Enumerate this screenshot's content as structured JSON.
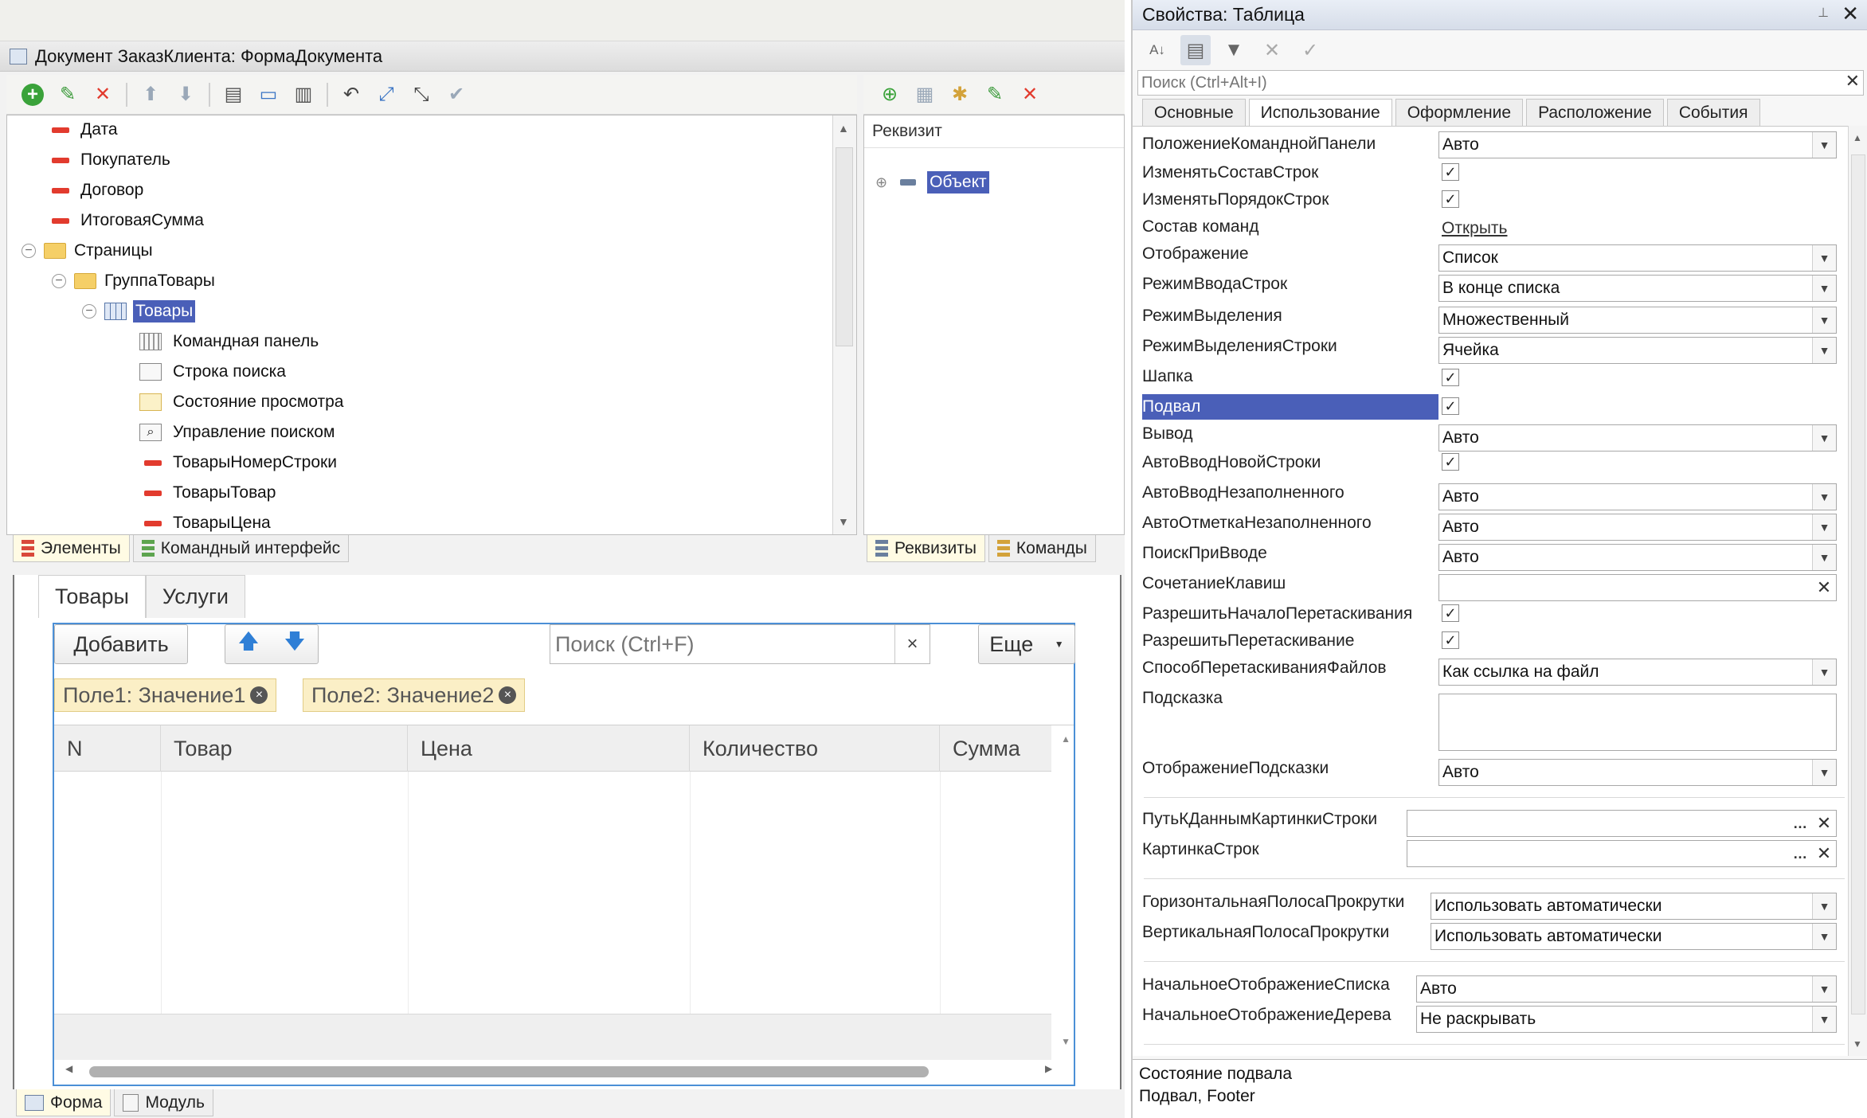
{
  "left_window": {
    "title": "Документ ЗаказКлиента: ФормаДокумента",
    "elements_tree": [
      {
        "label": "Дата",
        "icon": "attribute-icon"
      },
      {
        "label": "Покупатель",
        "icon": "attribute-icon"
      },
      {
        "label": "Договор",
        "icon": "attribute-icon"
      },
      {
        "label": "ИтоговаяСумма",
        "icon": "attribute-icon"
      },
      {
        "label": "Страницы",
        "icon": "folder-icon"
      },
      {
        "label": "ГруппаТовары",
        "icon": "folder-icon"
      },
      {
        "label": "Товары",
        "icon": "table-icon"
      },
      {
        "label": "Командная панель",
        "icon": "command-bar-icon"
      },
      {
        "label": "Строка поиска",
        "icon": "search-string-icon"
      },
      {
        "label": "Состояние просмотра",
        "icon": "view-status-icon"
      },
      {
        "label": "Управление поиском",
        "icon": "search-control-icon"
      },
      {
        "label": "ТоварыНомерСтроки",
        "icon": "attribute-icon"
      },
      {
        "label": "ТоварыТовар",
        "icon": "attribute-icon"
      },
      {
        "label": "ТоварыЦена",
        "icon": "attribute-icon"
      }
    ],
    "elements_tabs": [
      "Элементы",
      "Командный интерфейс"
    ],
    "requisites_header": "Реквизит",
    "requisite_object": "Объект",
    "requisites_tabs": [
      "Реквизиты",
      "Команды"
    ],
    "preview": {
      "tabs": [
        "Товары",
        "Услуги"
      ],
      "add_button": "Добавить",
      "search_placeholder": "Поиск (Ctrl+F)",
      "more_button": "Еще",
      "filters": [
        "Поле1: Значение1",
        "Поле2: Значение2"
      ],
      "columns": [
        "N",
        "Товар",
        "Цена",
        "Количество",
        "Сумма"
      ]
    },
    "bottom_tabs": [
      "Форма",
      "Модуль"
    ]
  },
  "properties": {
    "title": "Свойства: Таблица",
    "search_placeholder": "Поиск (Ctrl+Alt+I)",
    "tabs": [
      "Основные",
      "Использование",
      "Оформление",
      "Расположение",
      "События"
    ],
    "rows": {
      "r1": {
        "label": "ПоложениеКоманднойПанели",
        "value": "Авто"
      },
      "r2": {
        "label": "ИзменятьСоставСтрок"
      },
      "r3": {
        "label": "ИзменятьПорядокСтрок"
      },
      "r4": {
        "label": "Состав команд",
        "value": "Открыть"
      },
      "r5": {
        "label": "Отображение",
        "value": "Список"
      },
      "r6": {
        "label": "РежимВводаСтрок",
        "value": "В конце списка"
      },
      "r7": {
        "label": "РежимВыделения",
        "value": "Множественный"
      },
      "r8": {
        "label": "РежимВыделенияСтроки",
        "value": "Ячейка"
      },
      "r9": {
        "label": "Шапка"
      },
      "r10": {
        "label": "Подвал"
      },
      "r11": {
        "label": "Вывод",
        "value": "Авто"
      },
      "r12": {
        "label": "АвтоВводНовойСтроки"
      },
      "r13": {
        "label": "АвтоВводНезаполненного",
        "value": "Авто"
      },
      "r14": {
        "label": "АвтоОтметкаНезаполненного",
        "value": "Авто"
      },
      "r15": {
        "label": "ПоискПриВводе",
        "value": "Авто"
      },
      "r16": {
        "label": "СочетаниеКлавиш",
        "value": ""
      },
      "r17": {
        "label": "РазрешитьНачалоПеретаскивания"
      },
      "r18": {
        "label": "РазрешитьПеретаскивание"
      },
      "r19": {
        "label": "СпособПеретаскиванияФайлов",
        "value": "Как ссылка на файл"
      },
      "r20": {
        "label": "Подсказка",
        "value": ""
      },
      "r21": {
        "label": "ОтображениеПодсказки",
        "value": "Авто"
      },
      "r22": {
        "label": "ПутьКДаннымКартинкиСтроки",
        "value": ""
      },
      "r23": {
        "label": "КартинкаСтрок",
        "value": ""
      },
      "r24": {
        "label": "ГоризонтальнаяПолосаПрокрутки",
        "value": "Использовать автоматически"
      },
      "r25": {
        "label": "ВертикальнаяПолосаПрокрутки",
        "value": "Использовать автоматически"
      },
      "r26": {
        "label": "НачальноеОтображениеСписка",
        "value": "Авто"
      },
      "r27": {
        "label": "НачальноеОтображениеДерева",
        "value": "Не раскрывать"
      }
    },
    "status_title": "Состояние подвала",
    "status_text": "Подвал, Footer"
  },
  "colors": {
    "selection": "#4a5fb8",
    "accent_red": "#e23b2e",
    "chip_bg": "#fbefc6",
    "preview_border": "#4b8fd6"
  }
}
